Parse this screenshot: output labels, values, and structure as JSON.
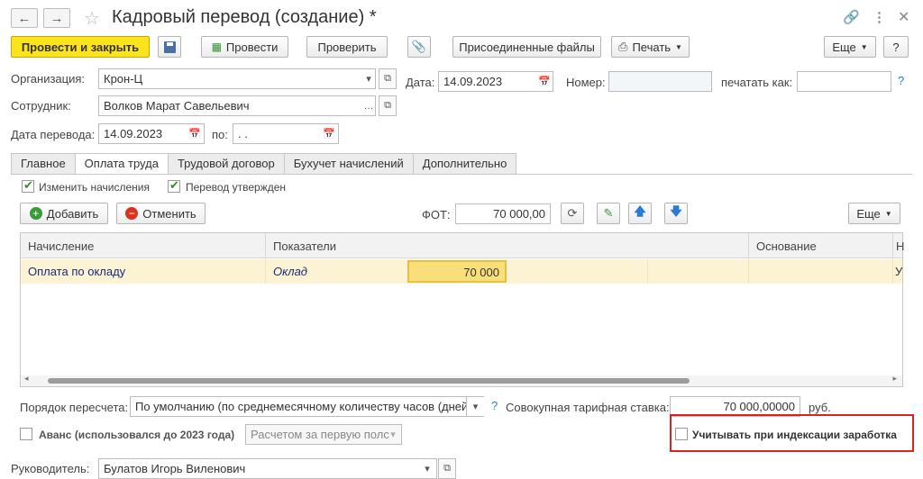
{
  "window": {
    "title": "Кадровый перевод (создание) *",
    "back_icon": "arrow-left-icon",
    "forward_icon": "arrow-right-icon",
    "star_icon": "star-icon",
    "link_icon": "link-icon",
    "menu_icon": "kebab-menu-icon",
    "close_icon": "close-icon"
  },
  "toolbar": {
    "post_close": "Провести и закрыть",
    "post": "Провести",
    "check": "Проверить",
    "attached": "Присоединенные файлы",
    "print": "Печать",
    "more": "Еще",
    "help": "?"
  },
  "form": {
    "org_label": "Организация:",
    "org_value": "Крон-Ц",
    "date_label": "Дата:",
    "date_value": "14.09.2023",
    "number_label": "Номер:",
    "number_value": "",
    "print_as_label": "печатать как:",
    "print_as_value": "",
    "help_link": "?",
    "employee_label": "Сотрудник:",
    "employee_value": "Волков Марат Савельевич",
    "transfer_date_label": "Дата перевода:",
    "transfer_date_value": "14.09.2023",
    "to_label": "по:",
    "to_value": " .  ."
  },
  "tabs": [
    "Главное",
    "Оплата труда",
    "Трудовой договор",
    "Бухучет начислений",
    "Дополнительно"
  ],
  "active_tab": 1,
  "pay": {
    "change_accruals": "Изменить начисления",
    "transfer_approved": "Перевод утвержден",
    "add": "Добавить",
    "cancel": "Отменить",
    "fot_label": "ФОТ:",
    "fot_value": "70 000,00",
    "more": "Еще"
  },
  "table": {
    "columns": [
      "Начисление",
      "Показатели",
      "Основание",
      "Н"
    ],
    "rows": [
      {
        "accrual": "Оплата по окладу",
        "indicator": "Оклад",
        "value": "70 000",
        "basis": "",
        "extra": "У"
      }
    ]
  },
  "bottom": {
    "recalc_label": "Порядок пересчета:",
    "recalc_value": "По умолчанию (по среднемесячному количеству часов (дней))",
    "help": "?",
    "rate_label": "Совокупная тарифная ставка:",
    "rate_value": "70 000,00000",
    "currency": "руб.",
    "advance_label": "Аванс (использовался до 2023 года)",
    "advance_value": "Расчетом за первую полс",
    "indexation_label": "Учитывать при индексации заработка",
    "manager_label": "Руководитель:",
    "manager_value": "Булатов Игорь Виленович"
  },
  "colors": {
    "primary_button": "#fbe31e",
    "selected_row": "#fbf3d3",
    "selected_cell": "#f9df7a",
    "highlight_frame": "#d9231f",
    "link": "#2a7bd6"
  }
}
